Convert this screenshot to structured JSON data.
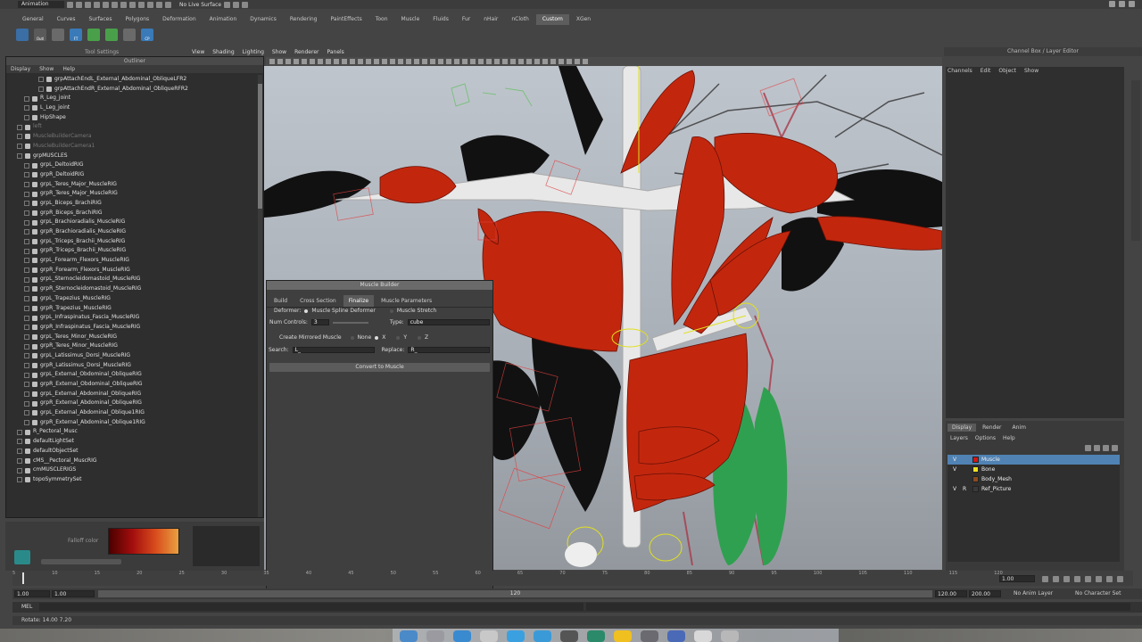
{
  "topbar": {
    "mode": "Animation",
    "live_surface": "No Live Surface"
  },
  "shelf_tabs": [
    {
      "label": "General",
      "active": false
    },
    {
      "label": "Curves",
      "active": false
    },
    {
      "label": "Surfaces",
      "active": false
    },
    {
      "label": "Polygons",
      "active": false
    },
    {
      "label": "Deformation",
      "active": false
    },
    {
      "label": "Animation",
      "active": false
    },
    {
      "label": "Dynamics",
      "active": false
    },
    {
      "label": "Rendering",
      "active": false
    },
    {
      "label": "PaintEffects",
      "active": false
    },
    {
      "label": "Toon",
      "active": false
    },
    {
      "label": "Muscle",
      "active": false
    },
    {
      "label": "Fluids",
      "active": false
    },
    {
      "label": "Fur",
      "active": false
    },
    {
      "label": "nHair",
      "active": false
    },
    {
      "label": "nCloth",
      "active": false
    },
    {
      "label": "Custom",
      "active": true
    },
    {
      "label": "XGen",
      "active": false
    }
  ],
  "shelf_icons": [
    {
      "label": "",
      "color": "#3a6ea5"
    },
    {
      "label": "Outl",
      "color": "#5a5a5a"
    },
    {
      "label": "",
      "color": "#6a6a6a"
    },
    {
      "label": "FT",
      "color": "#3a7ab8"
    },
    {
      "label": "",
      "color": "#4aa04a"
    },
    {
      "label": "",
      "color": "#4aa04a"
    },
    {
      "label": "",
      "color": "#6a6a6a"
    },
    {
      "label": "CP",
      "color": "#3a7ab8"
    }
  ],
  "tool_settings_label": "Tool Settings",
  "outliner": {
    "title": "Outliner",
    "menu": [
      "Display",
      "Show",
      "Help"
    ],
    "rows": [
      {
        "indent": 4,
        "label": "grpAttachEndL_External_Abdominal_ObliqueLFR2",
        "dim": false
      },
      {
        "indent": 4,
        "label": "grpAttachEndR_External_Abdominal_ObliqueRFR2",
        "dim": false
      },
      {
        "indent": 2,
        "label": "R_Leg_joint",
        "dim": false
      },
      {
        "indent": 2,
        "label": "L_Leg_joint",
        "dim": false
      },
      {
        "indent": 2,
        "label": "HipShape",
        "dim": false
      },
      {
        "indent": 1,
        "label": "left",
        "dim": true
      },
      {
        "indent": 1,
        "label": "MuscleBuilderCamera",
        "dim": true
      },
      {
        "indent": 1,
        "label": "MuscleBuilderCamera1",
        "dim": true
      },
      {
        "indent": 1,
        "label": "grpMUSCLES",
        "dim": false
      },
      {
        "indent": 2,
        "label": "grpL_DeltoidRIG",
        "dim": false
      },
      {
        "indent": 2,
        "label": "grpR_DeltoidRIG",
        "dim": false
      },
      {
        "indent": 2,
        "label": "grpL_Teres_Major_MuscleRIG",
        "dim": false
      },
      {
        "indent": 2,
        "label": "grpR_Teres_Major_MuscleRIG",
        "dim": false
      },
      {
        "indent": 2,
        "label": "grpL_Biceps_BrachiRIG",
        "dim": false
      },
      {
        "indent": 2,
        "label": "grpR_Biceps_BrachiRIG",
        "dim": false
      },
      {
        "indent": 2,
        "label": "grpL_Brachioradialis_MuscleRIG",
        "dim": false
      },
      {
        "indent": 2,
        "label": "grpR_Brachioradialis_MuscleRIG",
        "dim": false
      },
      {
        "indent": 2,
        "label": "grpL_Triceps_Brachii_MuscleRIG",
        "dim": false
      },
      {
        "indent": 2,
        "label": "grpR_Triceps_Brachii_MuscleRIG",
        "dim": false
      },
      {
        "indent": 2,
        "label": "grpL_Forearm_Flexors_MuscleRIG",
        "dim": false
      },
      {
        "indent": 2,
        "label": "grpR_Forearm_Flexors_MuscleRIG",
        "dim": false
      },
      {
        "indent": 2,
        "label": "grpL_Sternocleidomastoid_MuscleRIG",
        "dim": false
      },
      {
        "indent": 2,
        "label": "grpR_Sternocleidomastoid_MuscleRIG",
        "dim": false
      },
      {
        "indent": 2,
        "label": "grpL_Trapezius_MuscleRIG",
        "dim": false
      },
      {
        "indent": 2,
        "label": "grpR_Trapezius_MuscleRIG",
        "dim": false
      },
      {
        "indent": 2,
        "label": "grpL_Infraspinatus_Fascia_MuscleRIG",
        "dim": false
      },
      {
        "indent": 2,
        "label": "grpR_Infraspinatus_Fascia_MuscleRIG",
        "dim": false
      },
      {
        "indent": 2,
        "label": "grpL_Teres_Minor_MuscleRIG",
        "dim": false
      },
      {
        "indent": 2,
        "label": "grpR_Teres_Minor_MuscleRIG",
        "dim": false
      },
      {
        "indent": 2,
        "label": "grpL_Latissimus_Dorsi_MuscleRIG",
        "dim": false
      },
      {
        "indent": 2,
        "label": "grpR_Latissimus_Dorsi_MuscleRIG",
        "dim": false
      },
      {
        "indent": 2,
        "label": "grpL_External_Obdominal_ObliqueRIG",
        "dim": false
      },
      {
        "indent": 2,
        "label": "grpR_External_Obdominal_ObliqueRIG",
        "dim": false
      },
      {
        "indent": 2,
        "label": "grpL_External_Abdominal_ObliqueRIG",
        "dim": false
      },
      {
        "indent": 2,
        "label": "grpR_External_Abdominal_ObliqueRIG",
        "dim": false
      },
      {
        "indent": 2,
        "label": "grpL_External_Abdominal_Oblique1RIG",
        "dim": false
      },
      {
        "indent": 2,
        "label": "grpR_External_Abdominal_Oblique1RIG",
        "dim": false
      },
      {
        "indent": 1,
        "label": "R_Pectoral_Musc",
        "dim": false
      },
      {
        "indent": 1,
        "label": "defaultLightSet",
        "dim": false
      },
      {
        "indent": 1,
        "label": "defaultObjectSet",
        "dim": false
      },
      {
        "indent": 1,
        "label": "cMS__Pectoral_MuscRIG",
        "dim": false
      },
      {
        "indent": 1,
        "label": "cmMUSCLERIGS",
        "dim": false
      },
      {
        "indent": 1,
        "label": "topoSymmetrySet",
        "dim": false
      }
    ]
  },
  "ramp": {
    "label": "Falloff color"
  },
  "viewport_menu": [
    "View",
    "Shading",
    "Lighting",
    "Show",
    "Renderer",
    "Panels"
  ],
  "muscle_builder": {
    "title": "Muscle Builder",
    "tabs": [
      {
        "label": "Build",
        "active": false
      },
      {
        "label": "Cross Section",
        "active": false
      },
      {
        "label": "Finalize",
        "active": true
      },
      {
        "label": "Muscle Parameters",
        "active": false
      }
    ],
    "deformer_label": "Deformer:",
    "deformer_opt1": "Muscle Spline Deformer",
    "deformer_opt2": "Muscle Stretch",
    "num_controls_label": "Num Controls:",
    "num_controls_value": "3",
    "type_label": "Type:",
    "type_value": "cube",
    "mirror_label": "Create Mirrored Muscle",
    "mirror_none": "None",
    "mirror_x": "X",
    "mirror_y": "Y",
    "mirror_z": "Z",
    "search_label": "Search:",
    "search_value": "L_",
    "replace_label": "Replace:",
    "replace_value": "R_",
    "convert_button": "Convert to Muscle"
  },
  "channel_box": {
    "title": "Channel Box / Layer Editor",
    "menu": [
      "Channels",
      "Edit",
      "Object",
      "Show"
    ]
  },
  "layer_editor": {
    "tabs": [
      {
        "label": "Display",
        "active": true
      },
      {
        "label": "Render",
        "active": false
      },
      {
        "label": "Anim",
        "active": false
      }
    ],
    "menu": [
      "Layers",
      "Options",
      "Help"
    ],
    "layers": [
      {
        "v": "V",
        "p": "",
        "color": "#d01818",
        "name": "Muscle",
        "selected": true
      },
      {
        "v": "V",
        "p": "",
        "color": "#f0e020",
        "name": "Bone",
        "selected": false
      },
      {
        "v": "",
        "p": "",
        "color": "#8a4a20",
        "name": "Body_Mesh",
        "selected": false
      },
      {
        "v": "V",
        "p": "R",
        "color": "#3a3a3a",
        "name": "Ref_Picture",
        "selected": false
      }
    ]
  },
  "timeline": {
    "ticks": [
      "5",
      "10",
      "15",
      "20",
      "25",
      "30",
      "35",
      "40",
      "45",
      "50",
      "55",
      "60",
      "65",
      "70",
      "75",
      "80",
      "85",
      "90",
      "95",
      "100",
      "105",
      "110",
      "115",
      "120"
    ],
    "current_frame": "1.00"
  },
  "range": {
    "start": "1.00",
    "start_inner": "1.00",
    "slider_mid": "120",
    "end_inner": "120.00",
    "end": "200.00",
    "anim_layer": "No Anim Layer",
    "char_set": "No Character Set"
  },
  "command_line": {
    "label": "MEL"
  },
  "help_line": {
    "text": "Rotate: 14.00  7.20"
  }
}
